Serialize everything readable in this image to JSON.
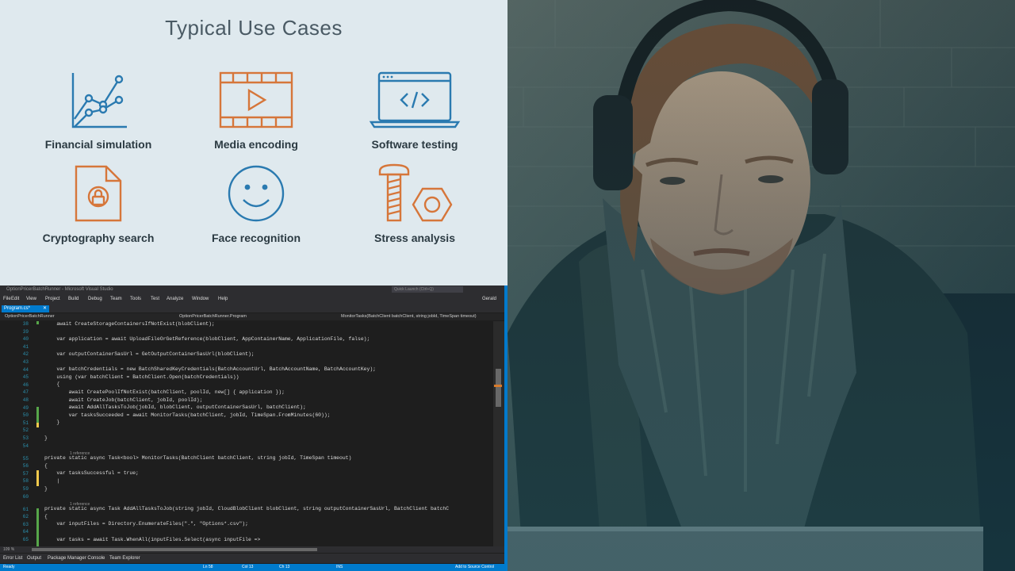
{
  "slide": {
    "title": "Typical Use Cases",
    "use_cases": [
      {
        "label": "Financial simulation",
        "icon": "line-chart-icon"
      },
      {
        "label": "Media encoding",
        "icon": "film-play-icon"
      },
      {
        "label": "Software testing",
        "icon": "laptop-code-icon"
      },
      {
        "label": "Cryptography search",
        "icon": "locked-document-icon"
      },
      {
        "label": "Face recognition",
        "icon": "smiley-face-icon"
      },
      {
        "label": "Stress analysis",
        "icon": "screw-nut-icon"
      }
    ],
    "colors": {
      "blue": "#2a7ab0",
      "orange": "#d6763a",
      "background": "#dfe9ee"
    }
  },
  "vs": {
    "window_title": "OptionPricerBatchRunner - Microsoft Visual Studio",
    "quick_launch": "Quick Launch (Ctrl+Q)",
    "menu": [
      "File",
      "Edit",
      "View",
      "Project",
      "Build",
      "Debug",
      "Team",
      "Tools",
      "Test",
      "Analyze",
      "Window",
      "Help"
    ],
    "user": "Gerald",
    "tab": "Program.cs*",
    "nav": {
      "project": "OptionPricerBatchRunner",
      "class": "OptionPricerBatchRunner.Program",
      "member": "MonitorTasks(BatchClient batchClient, string jobId, TimeSpan timeout)"
    },
    "references": [
      "1 reference",
      "1 reference"
    ],
    "zoom": "109 %",
    "bottom_tabs": [
      "Error List",
      "Output",
      "Package Manager Console",
      "Team Explorer"
    ],
    "status": {
      "ready": "Ready",
      "line": "Ln 58",
      "col": "Col 13",
      "ch": "Ch 13",
      "mode": "INS",
      "source_control": "Add to Source Control"
    },
    "code_lines": [
      {
        "n": "38",
        "text": "    await CreateStorageContainersIfNotExist(blobClient);"
      },
      {
        "n": "39",
        "text": ""
      },
      {
        "n": "40",
        "text": "    var application = await UploadFileOrGetReference(blobClient, AppContainerName, ApplicationFile, false);"
      },
      {
        "n": "41",
        "text": ""
      },
      {
        "n": "42",
        "text": "    var outputContainerSasUrl = GetOutputContainerSasUrl(blobClient);"
      },
      {
        "n": "43",
        "text": ""
      },
      {
        "n": "44",
        "text": "    var batchCredentials = new BatchSharedKeyCredentials(BatchAccountUrl, BatchAccountName, BatchAccountKey);"
      },
      {
        "n": "45",
        "text": "    using (var batchClient = BatchClient.Open(batchCredentials))"
      },
      {
        "n": "46",
        "text": "    {"
      },
      {
        "n": "47",
        "text": "        await CreatePoolIfNotExist(batchClient, poolId, new[] { application });"
      },
      {
        "n": "48",
        "text": "        await CreateJob(batchClient, jobId, poolId);"
      },
      {
        "n": "49",
        "text": "        await AddAllTasksToJob(jobId, blobClient, outputContainerSasUrl, batchClient);"
      },
      {
        "n": "50",
        "text": "        var tasksSucceeded = await MonitorTasks(batchClient, jobId, TimeSpan.FromMinutes(60));"
      },
      {
        "n": "51",
        "text": "    }"
      },
      {
        "n": "52",
        "text": ""
      },
      {
        "n": "53",
        "text": "}"
      },
      {
        "n": "54",
        "text": ""
      },
      {
        "n": "55",
        "text": "private static async Task<bool> MonitorTasks(BatchClient batchClient, string jobId, TimeSpan timeout)"
      },
      {
        "n": "56",
        "text": "{"
      },
      {
        "n": "57",
        "text": "    var tasksSuccessful = true;"
      },
      {
        "n": "58",
        "text": "    |"
      },
      {
        "n": "59",
        "text": "}"
      },
      {
        "n": "60",
        "text": ""
      },
      {
        "n": "61",
        "text": "private static async Task AddAllTasksToJob(string jobId, CloudBlobClient blobClient, string outputContainerSasUrl, BatchClient batchC"
      },
      {
        "n": "62",
        "text": "{"
      },
      {
        "n": "63",
        "text": "    var inputFiles = Directory.EnumerateFiles(\".\", \"Options*.csv\");"
      },
      {
        "n": "64",
        "text": ""
      },
      {
        "n": "65",
        "text": "    var tasks = await Task.WhenAll(inputFiles.Select(async inputFile =>"
      }
    ]
  }
}
